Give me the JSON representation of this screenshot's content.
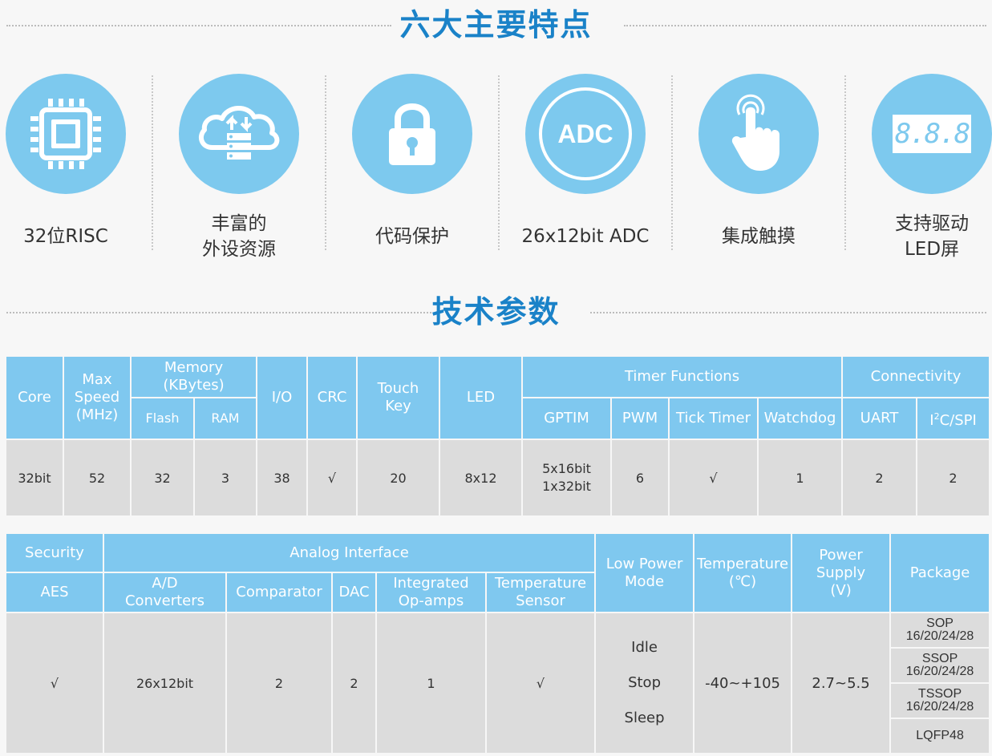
{
  "section1_title": "六大主要特点",
  "section2_title": "技术参数",
  "features": [
    {
      "icon": "cpu-chip-icon",
      "label": "32位RISC"
    },
    {
      "icon": "cloud-storage-icon",
      "label": "丰富的\n外设资源"
    },
    {
      "icon": "lock-icon",
      "label": "代码保护"
    },
    {
      "icon": "adc-icon",
      "icon_text": "ADC",
      "label": "26x12bit ADC"
    },
    {
      "icon": "touch-finger-icon",
      "label": "集成触摸"
    },
    {
      "icon": "led-display-icon",
      "icon_text": "8.8.8",
      "label": "支持驱动\nLED屏"
    }
  ],
  "table1": {
    "headers": {
      "core": "Core",
      "max_speed": "Max\nSpeed\n(MHz)",
      "memory": "Memory\n(KBytes)",
      "flash": "Flash",
      "ram": "RAM",
      "io": "I/O",
      "crc": "CRC",
      "touch": "Touch\nKey",
      "led": "LED",
      "timer": "Timer Functions",
      "gptim": "GPTIM",
      "pwm": "PWM",
      "tick": "Tick Timer",
      "watchdog": "Watchdog",
      "connectivity": "Connectivity",
      "uart": "UART",
      "i2c_spi_pre": "I",
      "i2c_spi_sup": "2",
      "i2c_spi_post": "C/SPI"
    },
    "row": {
      "core": "32bit",
      "max_speed": "52",
      "flash": "32",
      "ram": "3",
      "io": "38",
      "crc": "√",
      "touch": "20",
      "led": "8x12",
      "gptim": "5x16bit\n1x32bit",
      "pwm": "6",
      "tick": "√",
      "watchdog": "1",
      "uart": "2",
      "i2c_spi": "2"
    }
  },
  "table2": {
    "headers": {
      "security": "Security",
      "aes": "AES",
      "analog": "Analog Interface",
      "adc": "A/D\nConverters",
      "comparator": "Comparator",
      "dac": "DAC",
      "opamp": "Integrated\nOp-amps",
      "temp_sensor": "Temperature\nSensor",
      "low_power": "Low Power\nMode",
      "temperature": "Temperature\n(℃)",
      "power_supply": "Power Supply\n(V)",
      "package": "Package"
    },
    "row": {
      "aes": "√",
      "adc": "26x12bit",
      "comparator": "2",
      "dac": "2",
      "opamp": "1",
      "temp_sensor": "√",
      "low_power_modes": [
        "Idle",
        "Stop",
        "Sleep"
      ],
      "temperature": "-40~+105",
      "power_supply": "2.7~5.5",
      "packages": [
        {
          "name": "SOP",
          "pins": "16/20/24/28"
        },
        {
          "name": "SSOP",
          "pins": "16/20/24/28"
        },
        {
          "name": "TSSOP",
          "pins": "16/20/24/28"
        },
        {
          "name": "LQFP48",
          "pins": ""
        }
      ]
    }
  },
  "colors": {
    "accent": "#1a82c8",
    "header_bg": "#7fc8ef",
    "icon_bg": "#7dc9ee",
    "cell_bg": "#dcdcdc"
  }
}
